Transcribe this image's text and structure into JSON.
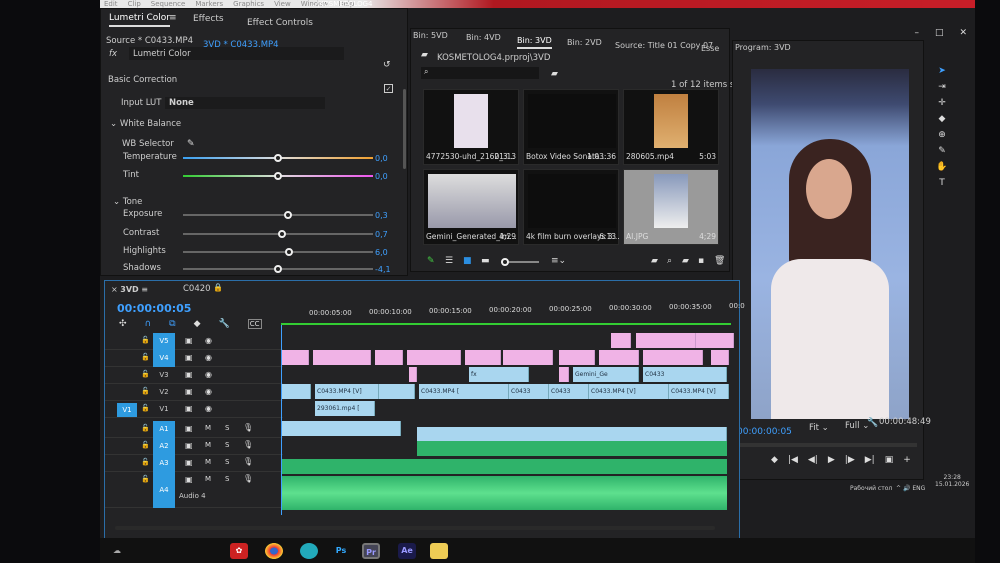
{
  "window": {
    "title": "...\\KOSMETOLOG4",
    "menu": [
      "Edit",
      "Clip",
      "Sequence",
      "Markers",
      "Graphics",
      "View",
      "Window",
      "Help"
    ],
    "controls": [
      "–",
      "□",
      "✕"
    ]
  },
  "left_panel": {
    "tabs": [
      "Lumetri Color",
      "Effects",
      "Effect Controls"
    ],
    "source": "Source * C0433.MP4",
    "sequence_clip": "3VD * C0433.MP4",
    "fx_label": "fx",
    "effect": "Lumetri Color",
    "basic_correction": "Basic Correction",
    "input_lut_label": "Input LUT",
    "input_lut_value": "None",
    "white_balance": "White Balance",
    "wb_selector": "WB Selector",
    "tone": "Tone",
    "sliders": [
      {
        "label": "Temperature",
        "value": "0,0",
        "pos": 0.5
      },
      {
        "label": "Tint",
        "value": "0,0",
        "pos": 0.5
      },
      {
        "label": "Exposure",
        "value": "0,3",
        "pos": 0.55
      },
      {
        "label": "Contrast",
        "value": "0,7",
        "pos": 0.52
      },
      {
        "label": "Highlights",
        "value": "6,0",
        "pos": 0.56
      },
      {
        "label": "Shadows",
        "value": "-4,1",
        "pos": 0.5
      }
    ]
  },
  "project": {
    "tabs": [
      "Bin: 5VD",
      "Bin: 4VD",
      "Bin: 3VD",
      "Bin: 2VD",
      "Source: Title 01 Copy 07",
      "Esse"
    ],
    "path": "KOSMETOLOG4.prproj\\3VD",
    "search_placeholder": "",
    "selection": "1 of 12 items selected",
    "items": [
      {
        "name": "4772530-uhd_2160_3...",
        "duration": "21:13"
      },
      {
        "name": "Botox Video Sonata ...",
        "duration": "1:03:36"
      },
      {
        "name": "280605.mp4",
        "duration": "5:03"
      },
      {
        "name": "Gemini_Generated_Im...",
        "duration": "4;29"
      },
      {
        "name": "4k film burn overlays 3...",
        "duration": "6:13"
      },
      {
        "name": "AI.JPG",
        "duration": "4;29"
      }
    ]
  },
  "program": {
    "title": "Program: 3VD",
    "timecode": "00:00:00:05",
    "fit": "Fit",
    "quality": "Full",
    "duration": "00:00:48:49"
  },
  "timeline": {
    "sequence_tab": "3VD",
    "clip_name": "C0420",
    "timecode": "00:00:00:05",
    "ruler": [
      "00:00:05:00",
      "00:00:10:00",
      "00:00:15:00",
      "00:00:20:00",
      "00:00:25:00",
      "00:00:30:00",
      "00:00:35:00",
      "00:0"
    ],
    "video_tracks": [
      "V5",
      "V4",
      "V3",
      "V2",
      "V1"
    ],
    "audio_tracks": [
      "A1",
      "A2",
      "A3",
      "A4"
    ],
    "source_patch": "V1",
    "audio4_name": "Audio 4",
    "mute": "M",
    "solo": "S",
    "clip_labels": [
      "C0433.MP4 [V]",
      "C0433.MP4 [",
      "C0433",
      "C0433",
      "C0433.MP4 [V]",
      "C0433.MP4 [V]",
      "C0433",
      "Gemini_Ge",
      "293061.mp4 [",
      "fx"
    ]
  },
  "taskbar": {
    "apps": [
      "Ps",
      "Pr",
      "Ae"
    ],
    "desktop_label": "Рабочий стол",
    "lang": "ENG",
    "time": "23:28",
    "date": "15.01.2026"
  }
}
